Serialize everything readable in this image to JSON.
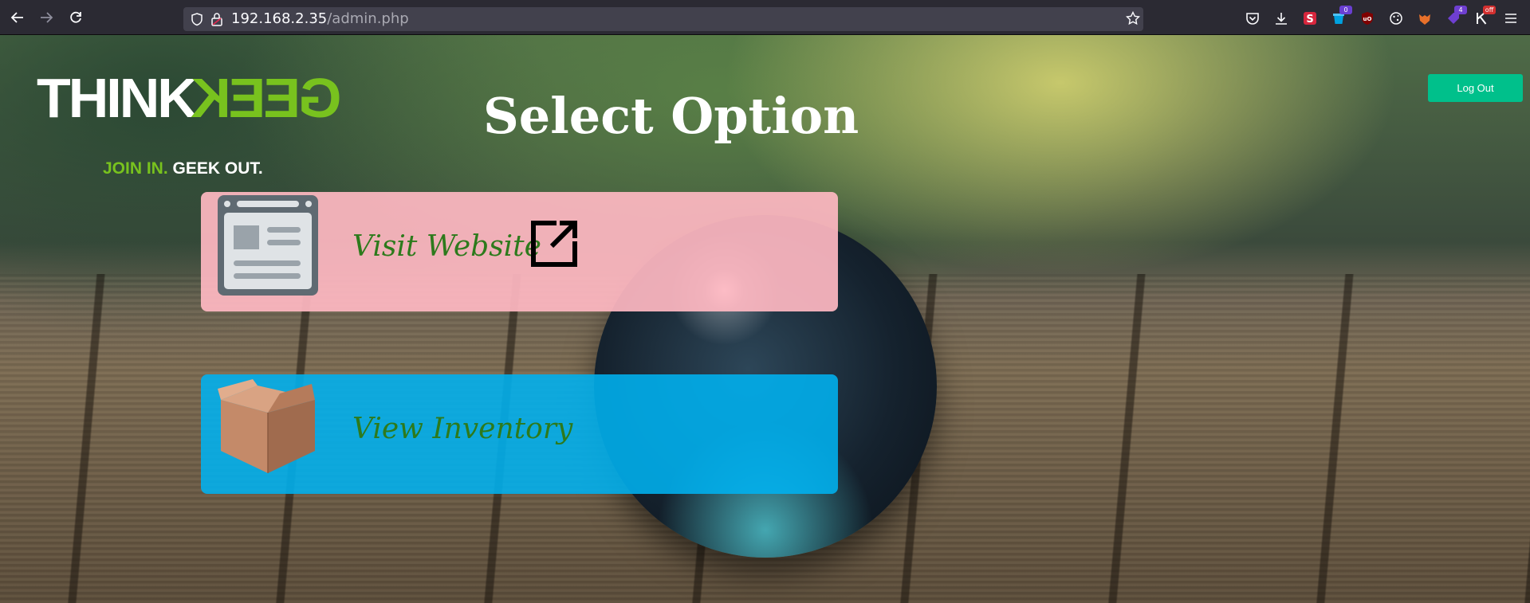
{
  "browser": {
    "url_host": "192.168.2.35",
    "url_path": "/admin.php",
    "extensions": [
      {
        "name": "pocket-icon"
      },
      {
        "name": "downloads-icon"
      },
      {
        "name": "extension-s-icon",
        "color": "#d7263d"
      },
      {
        "name": "extension-bucket-icon",
        "badge": "0",
        "color": "#00a1e0"
      },
      {
        "name": "ublock-icon",
        "color": "#800000"
      },
      {
        "name": "cookie-icon"
      },
      {
        "name": "foxyproxy-icon",
        "color": "#e8702a"
      },
      {
        "name": "extension-tag-icon",
        "badge": "4",
        "color": "#6f3fd1"
      },
      {
        "name": "extension-k-icon",
        "badge": "off",
        "color": "#d32f2f"
      },
      {
        "name": "menu-icon"
      }
    ]
  },
  "logo": {
    "think": "THINK",
    "geek": "GEEK",
    "tagline_green": "JOIN IN.",
    "tagline_white": "GEEK OUT."
  },
  "page": {
    "title": "Select Option",
    "logout_label": "Log Out"
  },
  "options": [
    {
      "label": "Visit Website",
      "icon": "website-icon",
      "color": "#ffb8c2"
    },
    {
      "label": "View Inventory",
      "icon": "box-icon",
      "color": "#00b2f0"
    }
  ]
}
